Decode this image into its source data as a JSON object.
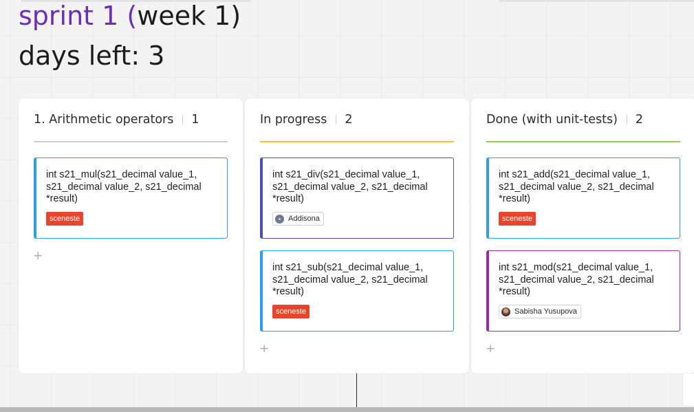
{
  "board": {
    "title_prefix": "sprint 1 (",
    "title_suffix": "week 1)",
    "days_left": "days left: 3"
  },
  "columns": [
    {
      "title": "1. Arithmetic operators",
      "count": "1",
      "accent": "#cccccc",
      "cards": [
        {
          "text": "int s21_mul(s21_decimal value_1, s21_decimal value_2, s21_decimal *result)",
          "border_color": "#2d9bf0",
          "tag": "sceneste"
        }
      ],
      "add_icon": "plus-icon"
    },
    {
      "title": "In progress",
      "count": "2",
      "accent": "#f5c230",
      "cards": [
        {
          "text": "int s21_div(s21_decimal value_1, s21_decimal value_2, s21_decimal *result)",
          "border_color": "#4c4cb8",
          "user": "Addisona"
        },
        {
          "text": "int s21_sub(s21_decimal value_1, s21_decimal value_2, s21_decimal *result)",
          "border_color": "#2d9bf0",
          "tag": "sceneste"
        }
      ],
      "add_icon": "plus-icon"
    },
    {
      "title": "Done (with unit-tests)",
      "count": "2",
      "accent": "#8fd14f",
      "cards": [
        {
          "text": "int s21_add(s21_decimal value_1, s21_decimal value_2, s21_decimal *result)",
          "border_color": "#2d9bf0",
          "tag": "sceneste"
        },
        {
          "text": "int s21_mod(s21_decimal value_1, s21_decimal value_2, s21_decimal *result)",
          "border_color": "#9c27b0",
          "user": "Sabisha Yusupova"
        }
      ],
      "add_icon": "plus-icon"
    }
  ],
  "colors": {
    "title_accent": "#6a2fb5",
    "tag_background": "#e8452d"
  }
}
